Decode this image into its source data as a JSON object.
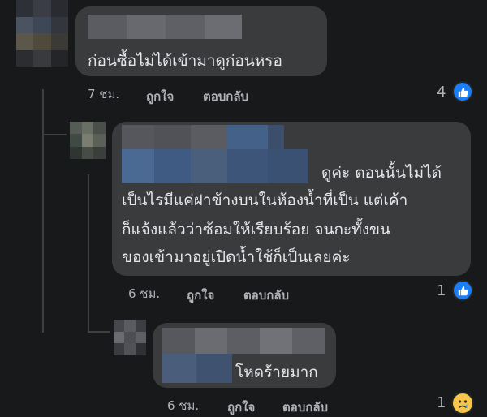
{
  "comments": [
    {
      "text_lines": [
        "ก่อนซื้อไม่ได้เข้ามาดูก่อนหรอ"
      ],
      "time": "7 ชม.",
      "like_label": "ถูกใจ",
      "reply_label": "ตอบกลับ",
      "reaction_count": "4",
      "reaction_icon": "thumbs-up-icon"
    },
    {
      "text_lines": [
        "ดูค่ะ ตอนนั้นไม่ได้",
        "เป็นไรมีแค่ฝาข้างบนในห้องน้ำที่เป็น แต่เค้า",
        "ก็แจ้งแล้วว่าซ้อมให้เรียบร้อย จนกะทั้งขน",
        "ของเข้ามาอยู่เปิดน้ำใช้ก็เป็นเลยค่ะ"
      ],
      "time": "6 ชม.",
      "like_label": "ถูกใจ",
      "reply_label": "ตอบกลับ",
      "reaction_count": "1",
      "reaction_icon": "thumbs-up-icon"
    },
    {
      "text_lines": [
        "โหดร้ายมาก"
      ],
      "time": "6 ชม.",
      "like_label": "ถูกใจ",
      "reply_label": "ตอบกลับ",
      "reaction_count": "1",
      "reaction_icon": "sad-face-icon"
    }
  ],
  "colors": {
    "background": "#18191a",
    "bubble": "#3a3b3c",
    "text": "#e4e6eb",
    "meta": "#b0b3b8",
    "like_blue": "#1a7ff5",
    "sad_yellow": "#f7c64b"
  }
}
